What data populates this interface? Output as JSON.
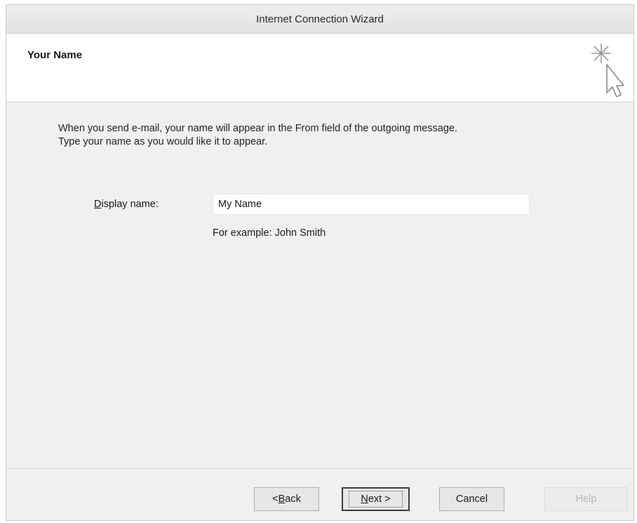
{
  "window": {
    "title": "Internet Connection Wizard"
  },
  "header": {
    "title": "Your Name",
    "icon": "wizard-cursor-sparkle-icon"
  },
  "content": {
    "description_line1": "When you send e-mail, your name will appear in the From field of the outgoing message.",
    "description_line2": "Type your name as you would like it to appear.",
    "display_name_label_accel": "D",
    "display_name_label_rest": "isplay name:",
    "display_name_value": "My Name",
    "example_text": "For example: John Smith"
  },
  "buttons": {
    "back_prefix": "< ",
    "back_accel": "B",
    "back_rest": "ack",
    "next_accel": "N",
    "next_rest": "ext >",
    "cancel": "Cancel",
    "help": "Help"
  }
}
